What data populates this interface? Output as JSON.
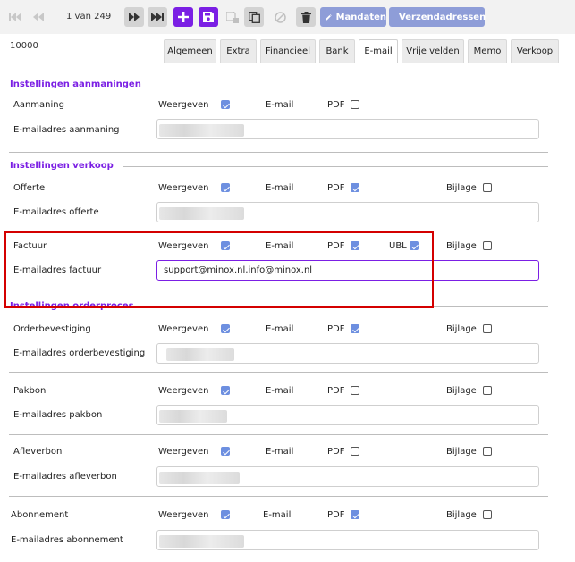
{
  "toolbar": {
    "pager": "1 van 249",
    "mandaten_label": "Mandaten",
    "verzendadressen_label": "Verzendadressen"
  },
  "record_id": "10000",
  "tabs": [
    "Algemeen",
    "Extra",
    "Financieel",
    "Bank",
    "E-mail",
    "Vrije velden",
    "Memo",
    "Verkoop"
  ],
  "active_tab": "E-mail",
  "labels": {
    "weergeven": "Weergeven",
    "email": "E-mail",
    "pdf": "PDF",
    "bijlage": "Bijlage",
    "ubl": "UBL"
  },
  "sections": {
    "aanmaningen": "Instellingen aanmaningen",
    "verkoop": "Instellingen verkoop",
    "orderproces": "Instellingen orderproces"
  },
  "rows": {
    "aanmaning": {
      "name": "Aanmaning",
      "email_label": "E-mailadres aanmaning",
      "weergeven": true,
      "pdf": false
    },
    "offerte": {
      "name": "Offerte",
      "email_label": "E-mailadres offerte",
      "weergeven": true,
      "pdf": true,
      "bijlage": false
    },
    "factuur": {
      "name": "Factuur",
      "email_label": "E-mailadres factuur",
      "weergeven": true,
      "pdf": true,
      "ubl": true,
      "bijlage": false,
      "email_value": "support@minox.nl,info@minox.nl"
    },
    "orderbevestiging": {
      "name": "Orderbevestiging",
      "email_label": "E-mailadres orderbevestiging",
      "weergeven": true,
      "pdf": true,
      "bijlage": false
    },
    "pakbon": {
      "name": "Pakbon",
      "email_label": "E-mailadres pakbon",
      "weergeven": true,
      "pdf": false,
      "bijlage": false
    },
    "afleverbon": {
      "name": "Afleverbon",
      "email_label": "E-mailadres afleverbon",
      "weergeven": true,
      "pdf": false,
      "bijlage": false
    },
    "abonnement": {
      "name": "Abonnement",
      "email_label": "E-mailadres abonnement",
      "weergeven": true,
      "pdf": true,
      "bijlage": false
    }
  },
  "colors": {
    "accent": "#7b1fe4",
    "button_secondary": "#8e9dd8",
    "checkbox_checked": "#6d8fe0",
    "highlight": "#d40000"
  }
}
